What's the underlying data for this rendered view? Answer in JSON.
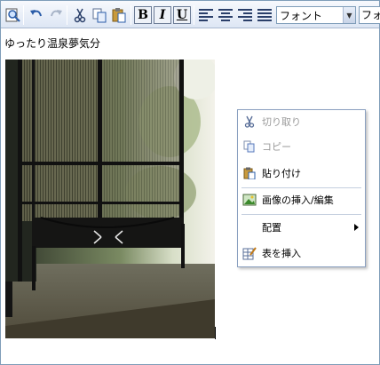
{
  "toolbar": {
    "font_value": "フォント",
    "font_value2": "フォ",
    "bold_label": "B",
    "italic_label": "I",
    "underline_label": "U"
  },
  "document": {
    "text": "ゆったり温泉夢気分"
  },
  "context_menu": {
    "items": [
      {
        "label": "切り取り",
        "icon": "scissors-icon",
        "enabled": false
      },
      {
        "label": "コピー",
        "icon": "copy-icon",
        "enabled": false
      },
      {
        "label": "貼り付け",
        "icon": "paste-icon",
        "enabled": true
      },
      {
        "label": "画像の挿入/編集",
        "icon": "image-icon",
        "enabled": true
      },
      {
        "label": "配置",
        "icon": "",
        "enabled": true,
        "submenu": true
      },
      {
        "label": "表を挿入",
        "icon": "table-icon",
        "enabled": true
      }
    ]
  },
  "colors": {
    "toolbar_top": "#f7f9fd",
    "toolbar_bottom": "#dde6f4",
    "border": "#7f9db9",
    "menu_border": "#8aa0c0",
    "disabled_text": "#9a9a9a"
  }
}
